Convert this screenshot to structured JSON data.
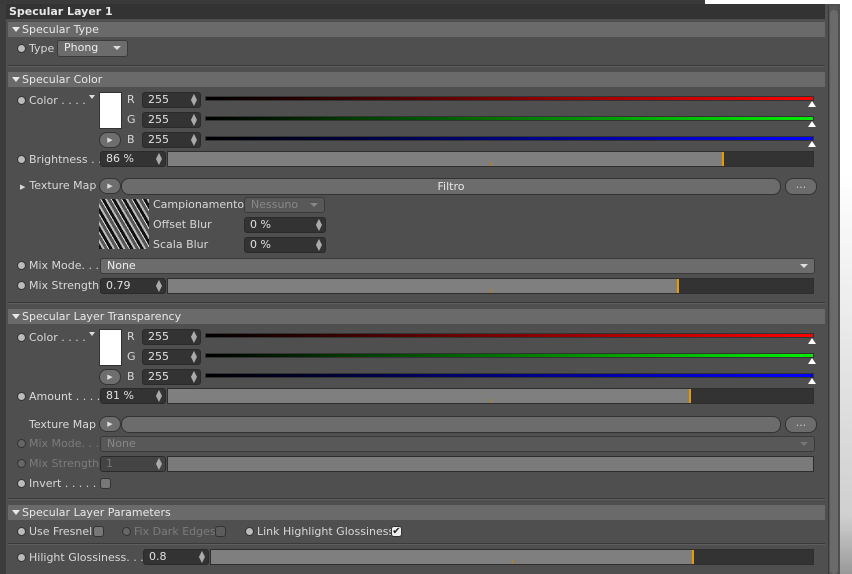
{
  "header": {
    "title": "Specular Layer 1"
  },
  "sections": {
    "type": "Specular Type",
    "color": "Specular Color",
    "transparency": "Specular Layer Transparency",
    "params": "Specular Layer Parameters"
  },
  "specular_type": {
    "label": "Type",
    "value": "Phong"
  },
  "specular_color": {
    "color_label": "Color . . . .",
    "r_label": "R",
    "g_label": "G",
    "b_label": "B",
    "r": "255",
    "g": "255",
    "b": "255",
    "brightness_label": "Brightness . .",
    "brightness": "86 %",
    "brightness_value": 86,
    "texture_map_label": "Texture Map",
    "texture_button": "Filtro",
    "more_button": "...",
    "sampling_label": "Campionamento",
    "sampling_value": "Nessuno",
    "offset_blur_label": "Offset Blur",
    "offset_blur": "0 %",
    "scala_blur_label": "Scala Blur",
    "scala_blur": "0 %",
    "mix_mode_label": "Mix Mode. . .",
    "mix_mode": "None",
    "mix_strength_label": "Mix Strength",
    "mix_strength": "0.79",
    "mix_strength_value": 0.79
  },
  "transparency": {
    "color_label": "Color . . . .",
    "r_label": "R",
    "g_label": "G",
    "b_label": "B",
    "r": "255",
    "g": "255",
    "b": "255",
    "amount_label": "Amount . . . .",
    "amount": "81 %",
    "amount_value": 81,
    "texture_map_label": "Texture Map",
    "more_button": "...",
    "mix_mode_label": "Mix Mode. . .",
    "mix_mode": "None",
    "mix_strength_label": "Mix Strength",
    "mix_strength": "1",
    "invert_label": "Invert . . . . . ."
  },
  "params": {
    "use_fresnel": "Use Fresnel",
    "use_fresnel_checked": false,
    "fix_dark_edges": "Fix Dark Edges",
    "fix_dark_edges_checked": false,
    "link_glossiness": "Link Highlight Glossiness",
    "link_glossiness_checked": true,
    "hilight_label": "Hilight Glossiness. . .",
    "hilight": "0.8",
    "hilight_value": 0.8
  },
  "colors": {
    "accent": "#e89a00",
    "red": "#ff0000",
    "green": "#00ee00",
    "blue": "#0000ff"
  }
}
